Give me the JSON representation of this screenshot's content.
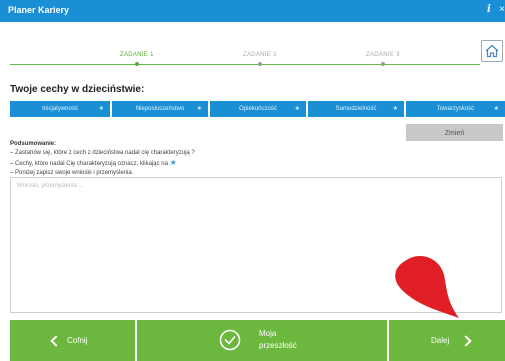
{
  "window": {
    "title": "Planer Kariery",
    "info_glyph": "i",
    "close_glyph": "×"
  },
  "steps": [
    {
      "label": "ZADANIE 1",
      "active": true
    },
    {
      "label": "ZADANIE 2",
      "active": false
    },
    {
      "label": "ZADANIE 3",
      "active": false
    }
  ],
  "section_title": "Twoje cechy w dzieciństwie:",
  "traits": [
    {
      "label": "Inicjatywność",
      "star": "★"
    },
    {
      "label": "Nieposłuszeństwo",
      "star": "★"
    },
    {
      "label": "Opiekuńczość",
      "star": "★"
    },
    {
      "label": "Samodzielność",
      "star": "★"
    },
    {
      "label": "Towarzyskość",
      "star": "★"
    }
  ],
  "change_button": "Zmień",
  "summary": {
    "heading": "Podsumowanie:",
    "lines": [
      "– Zastanów się, które z cech z dzieciństwa nadal cię charakteryzują ?",
      "– Cechy, które nadal Cię charakteryzują oznacz, klikając na",
      "– Poniżej zapisz swoje wnioski i przemyślenia."
    ],
    "star": "★"
  },
  "notes": {
    "placeholder": "Wnioski, przemyślenia ...",
    "value": ""
  },
  "footer": {
    "back": "Cofnij",
    "past_line1": "Moja",
    "past_line2": "przeszłość",
    "next": "Dalej"
  },
  "colors": {
    "titlebar": "#1a8fd6",
    "trait": "#1a8fd6",
    "footer": "#6cb83f",
    "step_active": "#5aa83a",
    "pointer": "#e01e26"
  },
  "icons": [
    "info-icon",
    "close-icon",
    "home-icon",
    "star-icon",
    "clock-icon",
    "chevron-left-icon",
    "chevron-right-icon"
  ]
}
